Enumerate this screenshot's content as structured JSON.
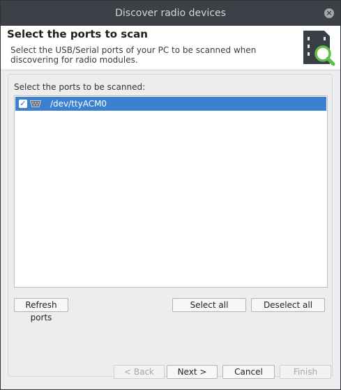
{
  "window": {
    "title": "Discover radio devices",
    "close_glyph": "×"
  },
  "background": {
    "glyphs": [
      "e",
      "e"
    ]
  },
  "header": {
    "title": "Select the ports to scan",
    "description": "Select the USB/Serial ports of your PC to be scanned when discovering for radio modules.",
    "icon": "sd-card-search-icon"
  },
  "ports": {
    "label": "Select the ports to be scanned:",
    "items": [
      {
        "label": "/dev/ttyACM0",
        "checked": true,
        "selected": true
      }
    ]
  },
  "actions": {
    "refresh": "Refresh ports",
    "select_all": "Select all",
    "deselect_all": "Deselect all"
  },
  "wizard": {
    "back": "< Back",
    "next": "Next >",
    "cancel": "Cancel",
    "finish": "Finish"
  },
  "colors": {
    "selection": "#3b81cf",
    "titlebar": "#3c4047",
    "icon_green": "#5cbf4a",
    "icon_dark": "#3a3f45"
  }
}
